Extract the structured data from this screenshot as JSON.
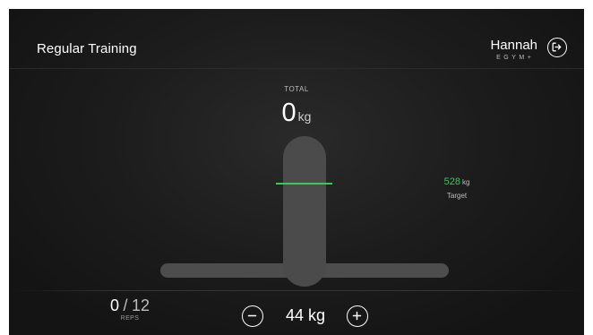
{
  "header": {
    "title": "Regular Training",
    "user_name": "Hannah",
    "brand": "EGYM+",
    "logout_icon": "logout-icon"
  },
  "total": {
    "label": "TOTAL",
    "value": "0",
    "unit": "kg"
  },
  "target": {
    "value": "528",
    "unit": "kg",
    "label": "Target",
    "color": "#3ec759"
  },
  "reps": {
    "current": "0",
    "separator": "/",
    "total": "12",
    "label": "REPS"
  },
  "weight": {
    "value": "44",
    "unit": "kg",
    "decrement_icon": "minus-icon",
    "increment_icon": "plus-icon"
  },
  "colors": {
    "accent": "#3ec759",
    "background": "#1c1c1c",
    "bar": "#4b4b4b"
  }
}
